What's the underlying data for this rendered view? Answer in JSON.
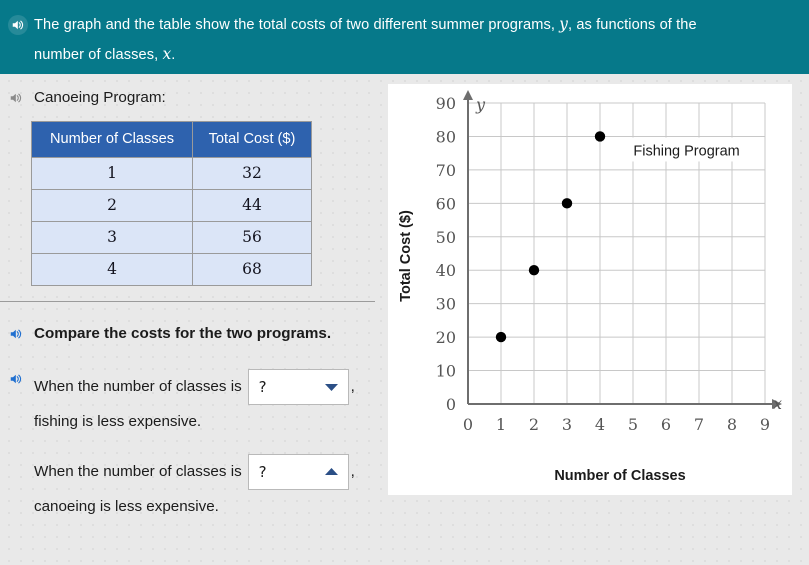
{
  "header": {
    "icon": "speaker-icon",
    "text_part1": "The graph and the table show the total costs of two different summer programs, ",
    "var_y": "y",
    "text_part2": ", as functions of the",
    "text_part3": "number of classes, ",
    "var_x": "x",
    "text_part4": ".",
    "bg_color": "#06798a"
  },
  "left": {
    "canoe_label": "Canoeing Program:",
    "table": {
      "headers": [
        "Number of Classes",
        "Total Cost ($)"
      ],
      "rows": [
        [
          "1",
          "32"
        ],
        [
          "2",
          "44"
        ],
        [
          "3",
          "56"
        ],
        [
          "4",
          "68"
        ]
      ],
      "header_bg": "#2e62ae",
      "cell_bg": "#dbe5f7"
    },
    "compare_heading": "Compare the costs for the two programs.",
    "q1": {
      "lead": "When the number of classes is",
      "dropdown_value": "?",
      "comma": ",",
      "tail": "fishing is less expensive.",
      "caret": "chevron-down-icon"
    },
    "q2": {
      "lead": "When the number of classes is",
      "dropdown_value": "?",
      "comma": ",",
      "tail": "canoeing is less expensive.",
      "caret": "chevron-up-icon"
    }
  },
  "chart_data": {
    "type": "scatter",
    "title": "",
    "series_label": "Fishing Program",
    "xlabel": "Number of Classes",
    "ylabel": "Total Cost ($)",
    "axis_var_x": "x",
    "axis_var_y": "y",
    "xlim": [
      0,
      9
    ],
    "ylim": [
      0,
      90
    ],
    "x_ticks": [
      "0",
      "1",
      "2",
      "3",
      "4",
      "5",
      "6",
      "7",
      "8",
      "9"
    ],
    "y_ticks": [
      "0",
      "10",
      "20",
      "30",
      "40",
      "50",
      "60",
      "70",
      "80",
      "90"
    ],
    "grid": true,
    "legend_position": "inside-top-right",
    "points": [
      {
        "x": 1,
        "y": 20
      },
      {
        "x": 2,
        "y": 40
      },
      {
        "x": 3,
        "y": 60
      },
      {
        "x": 4,
        "y": 80
      }
    ],
    "point_color": "#000000",
    "grid_color": "#c8c8c8",
    "axis_color": "#6e6e6e"
  }
}
